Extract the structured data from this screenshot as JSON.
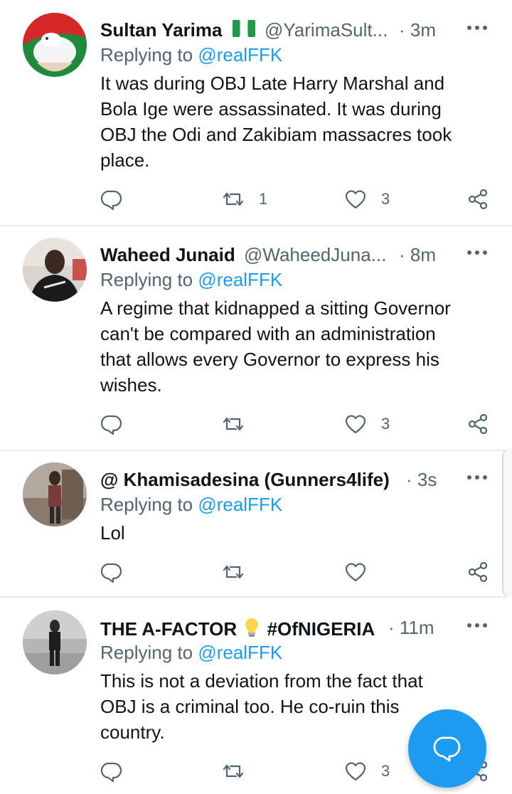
{
  "tweets": [
    {
      "name": "Sultan Yarima",
      "handle": "@YarimaSult...",
      "time": "· 3m",
      "reply_prefix": "Replying to",
      "reply_to": "@realFFK",
      "lines": [
        "It was during OBJ Late Harry Marshal and",
        "Bola Ige were assassinated. It was during",
        "OBJ the Odi and Zakibiam massacres took",
        "place."
      ],
      "retweets": "1",
      "likes": "3",
      "badge_icon": "nigeria-flag-icon"
    },
    {
      "name": "Waheed Junaid",
      "handle": "@WaheedJuna...",
      "time": "· 8m",
      "reply_prefix": "Replying to",
      "reply_to": "@realFFK",
      "lines": [
        "A regime that kidnapped a sitting Governor",
        "can't be compared with an administration",
        "that allows every Governor to express his",
        "wishes."
      ],
      "retweets": "",
      "likes": "3"
    },
    {
      "name": "@ Khamisadesina (Gunners4life)",
      "handle": "",
      "time": "· 3s",
      "reply_prefix": "Replying to",
      "reply_to": "@realFFK",
      "lines": [
        "Lol"
      ],
      "retweets": "",
      "likes": ""
    },
    {
      "name": "THE A-FACTOR",
      "name_suffix": "#OfNIGERIA",
      "handle": "",
      "time": "· 11m",
      "reply_prefix": "Replying to",
      "reply_to": "@realFFK",
      "lines": [
        "This is not a deviation from the fact that",
        "OBJ is a criminal too. He co-ruin this",
        "country."
      ],
      "retweets": "",
      "likes": "3",
      "badge_icon": "lightbulb-icon"
    }
  ],
  "icons": {
    "reply": "reply-icon",
    "retweet": "retweet-icon",
    "like": "heart-icon",
    "share": "share-icon",
    "more": "more-options-icon",
    "compose": "compose-reply-icon"
  },
  "colors": {
    "accent": "#1d9bf0",
    "text": "#0f1419",
    "muted": "#536471",
    "divider": "#e8ecef"
  }
}
